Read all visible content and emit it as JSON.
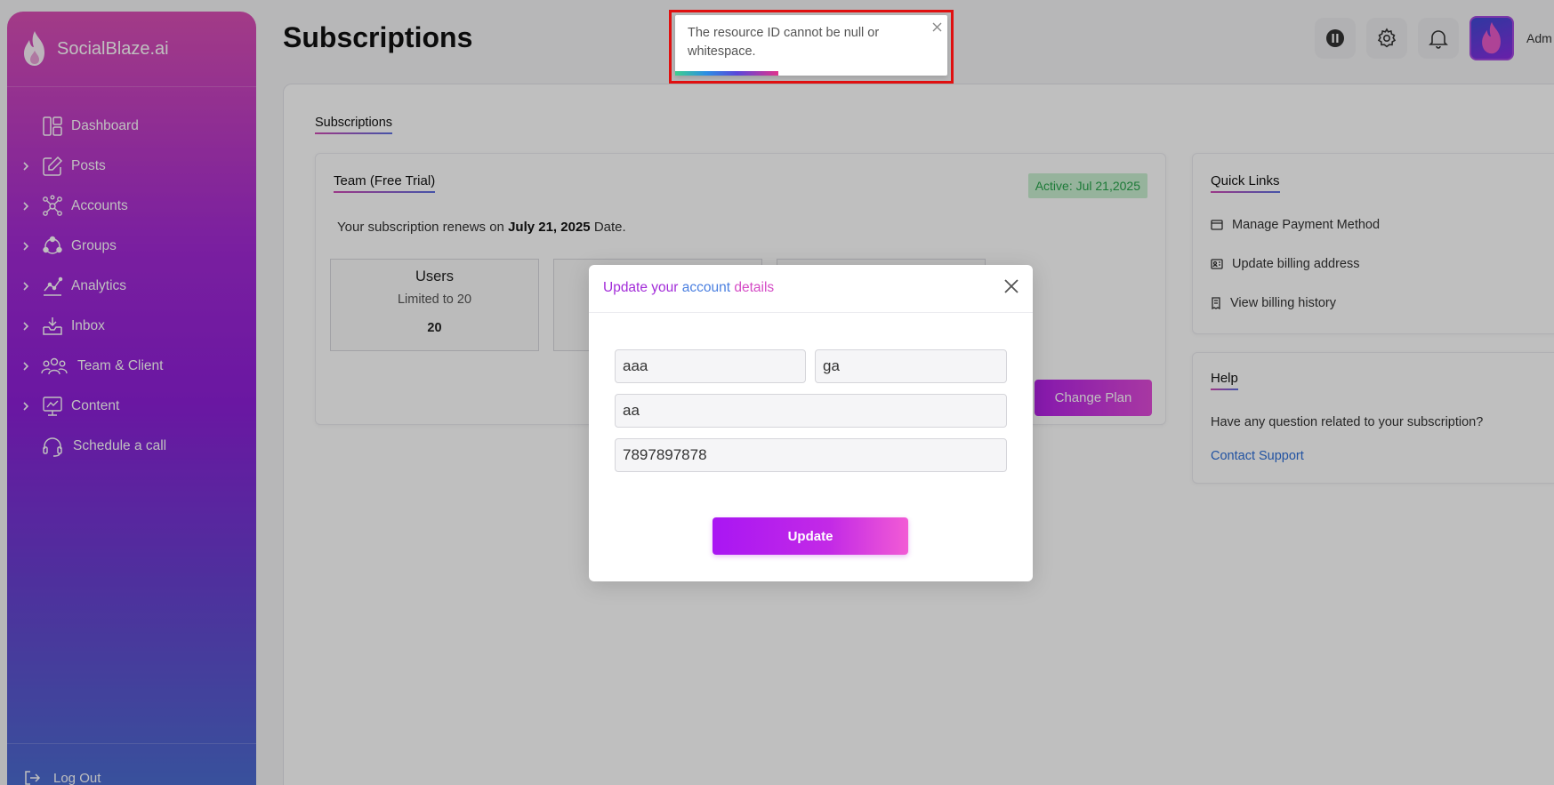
{
  "brand": {
    "name": "SocialBlaze.ai"
  },
  "sidebar": {
    "items": [
      {
        "label": "Dashboard",
        "icon": "dashboard-icon",
        "expandable": false
      },
      {
        "label": "Posts",
        "icon": "edit-icon",
        "expandable": true
      },
      {
        "label": "Accounts",
        "icon": "network-icon",
        "expandable": true
      },
      {
        "label": "Groups",
        "icon": "groups-icon",
        "expandable": true
      },
      {
        "label": "Analytics",
        "icon": "analytics-icon",
        "expandable": true
      },
      {
        "label": "Inbox",
        "icon": "inbox-icon",
        "expandable": true
      },
      {
        "label": "Team & Client",
        "icon": "team-icon",
        "expandable": true
      },
      {
        "label": "Content",
        "icon": "content-icon",
        "expandable": true
      },
      {
        "label": "Schedule a call",
        "icon": "headset-icon",
        "expandable": false
      }
    ],
    "logout_label": "Log Out"
  },
  "header": {
    "title": "Subscriptions",
    "admin_label": "Adm"
  },
  "main": {
    "tab_label": "Subscriptions",
    "plan": {
      "name": "Team (Free Trial)",
      "active_badge": "Active: Jul 21,2025",
      "renews_prefix": "Your subscription renews on",
      "renews_date": "July 21, 2025",
      "renews_suffix": "Date.",
      "stats": [
        {
          "title": "Users",
          "subtitle": "Limited to 20",
          "value": "20"
        },
        {
          "title": "",
          "subtitle": "",
          "value": ""
        },
        {
          "title": "",
          "subtitle": "",
          "value": ""
        }
      ],
      "change_plan_label": "Change Plan"
    },
    "quick_links": {
      "title": "Quick Links",
      "items": [
        {
          "label": "Manage Payment Method",
          "icon": "credit-card-icon"
        },
        {
          "label": "Update billing address",
          "icon": "address-card-icon"
        },
        {
          "label": "View billing history",
          "icon": "receipt-icon"
        }
      ]
    },
    "help": {
      "title": "Help",
      "text": "Have any question related to your subscription?",
      "link": "Contact Support"
    }
  },
  "modal": {
    "title_part1": "Update your",
    "title_part2": "account",
    "title_part3": "details",
    "fields": {
      "first_name": "aaa",
      "last_name": "ga",
      "company": "aa",
      "phone": "7897897878"
    },
    "update_label": "Update"
  },
  "toast": {
    "message": "The resource ID cannot be null or whitespace.",
    "progress": 0.38
  }
}
